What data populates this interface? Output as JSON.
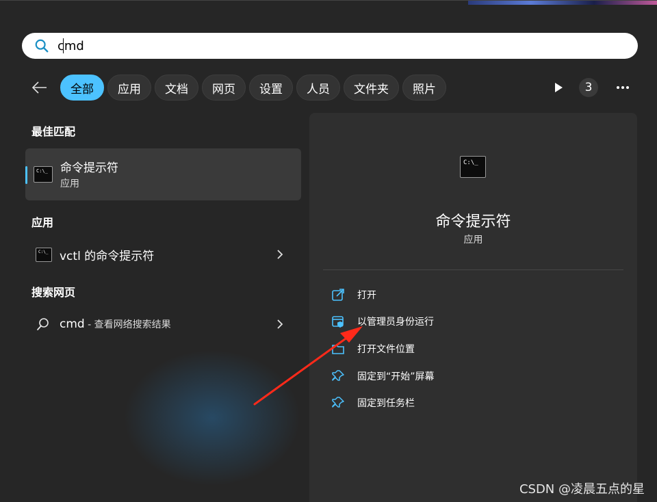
{
  "search": {
    "value": "cmd"
  },
  "filters": {
    "chips": [
      "全部",
      "应用",
      "文档",
      "网页",
      "设置",
      "人员",
      "文件夹",
      "照片"
    ],
    "count": "3"
  },
  "sections": {
    "best_match": "最佳匹配",
    "apps": "应用",
    "web": "搜索网页"
  },
  "best_match": {
    "title": "命令提示符",
    "subtitle": "应用",
    "icon_text": "C:\\_"
  },
  "apps": [
    {
      "label": "vctl 的命令提示符",
      "icon_text": "C:\\_"
    }
  ],
  "web": {
    "query": "cmd",
    "suffix": " - 查看网络搜索结果"
  },
  "panel": {
    "title": "命令提示符",
    "subtitle": "应用",
    "icon_text": "C:\\_",
    "actions": [
      {
        "label": "打开",
        "icon": "open-external-icon"
      },
      {
        "label": "以管理员身份运行",
        "icon": "admin-shield-icon"
      },
      {
        "label": "打开文件位置",
        "icon": "folder-icon"
      },
      {
        "label": "固定到“开始”屏幕",
        "icon": "pin-icon"
      },
      {
        "label": "固定到任务栏",
        "icon": "pin-icon"
      }
    ]
  },
  "watermark": "CSDN @凌晨五点的星",
  "colors": {
    "accent": "#4cc2ff",
    "arrow": "#ff2a1a",
    "panel": "#2f2f2f",
    "background": "#262626"
  }
}
